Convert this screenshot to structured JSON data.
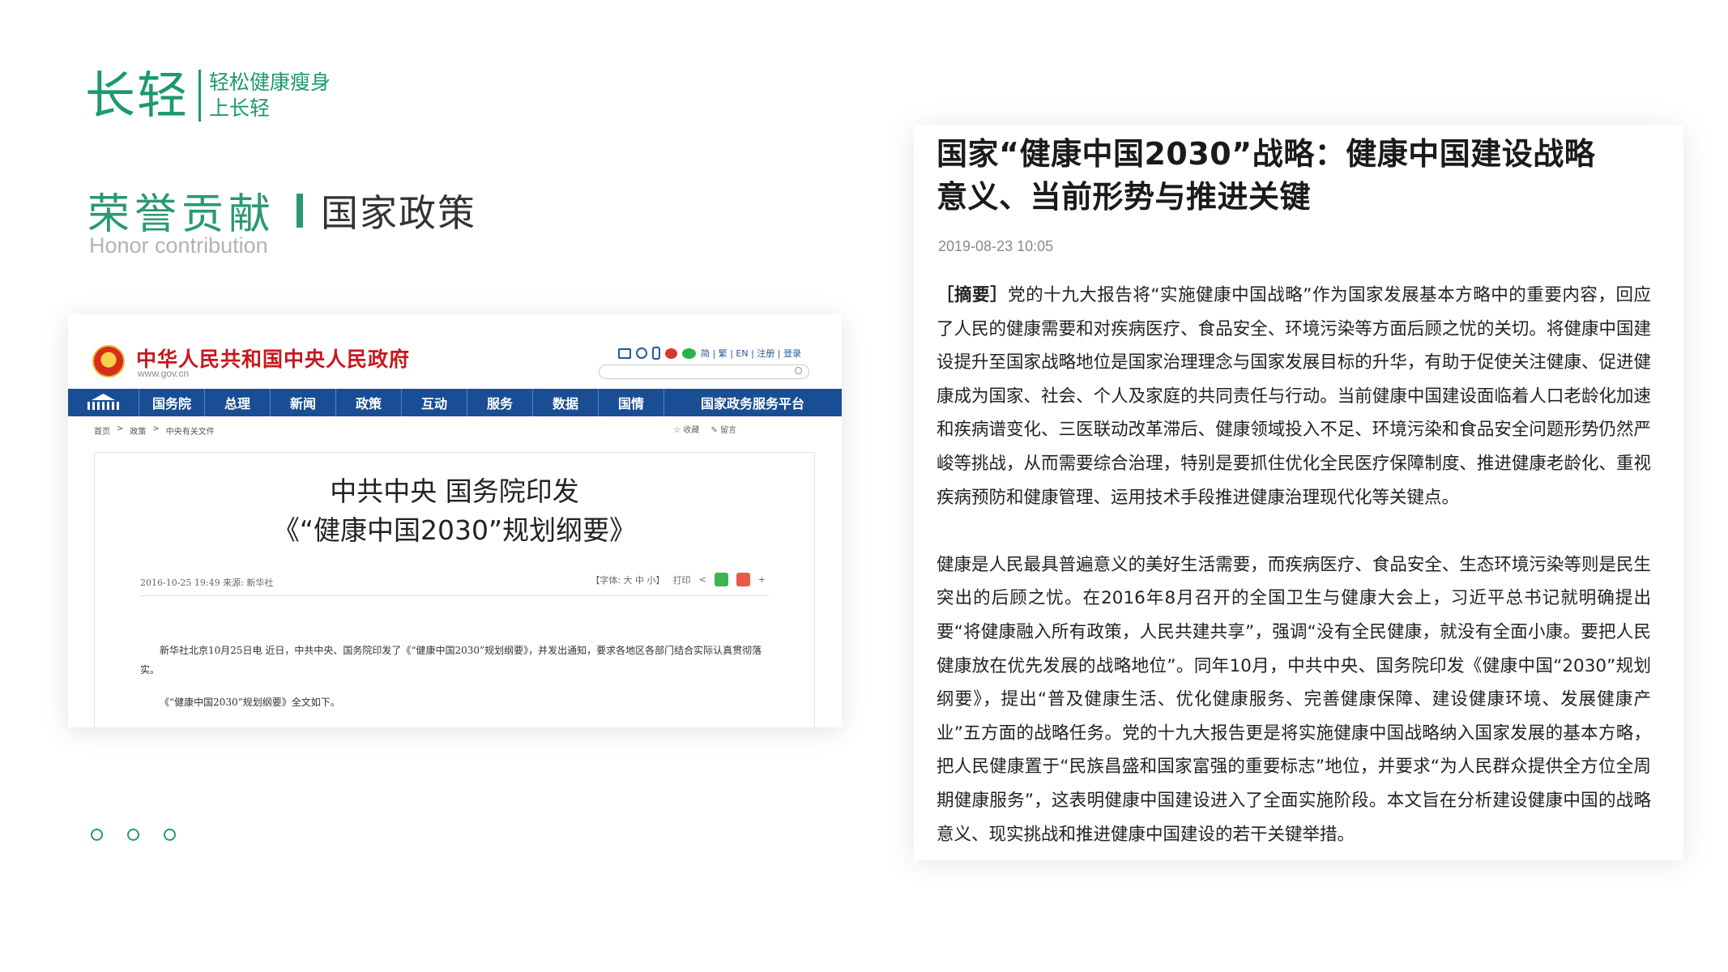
{
  "brand": {
    "logo_text": "长轻",
    "slogan_line1": "轻松健康瘦身",
    "slogan_line2": "上长轻",
    "color": "#1c9a6b"
  },
  "section": {
    "title": "荣誉贡献",
    "subtitle": "国家政策",
    "english": "Honor contribution"
  },
  "gov_site": {
    "title": "中华人民共和国中央人民政府",
    "url": "www.gov.cn",
    "tools": "简 | 繁 | EN | 注册 | 登录",
    "nav": [
      "国务院",
      "总理",
      "新闻",
      "政策",
      "互动",
      "服务",
      "数据",
      "国情",
      "国家政务服务平台"
    ],
    "breadcrumb": [
      "首页",
      ">",
      "政策",
      ">",
      "中央有关文件"
    ],
    "action_fav": "☆ 收藏",
    "action_comment": "✎ 留言",
    "doc_title_line1": "中共中央 国务院印发",
    "doc_title_line2": "《“健康中国2030”规划纲要》",
    "doc_meta": "2016-10-25 19:49   来源:  新华社",
    "doc_font": "【字体: 大 中 小】",
    "doc_print": "打印",
    "doc_para1": "新华社北京10月25日电 近日，中共中央、国务院印发了《“健康中国2030”规划纲要》，并发出通知，要求各地区各部门结合实际认真贯彻落实。",
    "doc_para2": "《“健康中国2030”规划纲要》全文如下。",
    "brand_color": "#1a4e94",
    "title_color": "#c8171c"
  },
  "article": {
    "title": "国家“健康中国2030”战略：健康中国建设战略意义、当前形势与推进关键",
    "date": "2019-08-23 10:05",
    "abstract_label": "［摘要］",
    "abstract_text": "党的十九大报告将“实施健康中国战略”作为国家发展基本方略中的重要内容，回应了人民的健康需要和对疾病医疗、食品安全、环境污染等方面后顾之忧的关切。将健康中国建设提升至国家战略地位是国家治理理念与国家发展目标的升华，有助于促使关注健康、促进健康成为国家、社会、个人及家庭的共同责任与行动。当前健康中国建设面临着人口老龄化加速和疾病谱变化、三医联动改革滞后、健康领域投入不足、环境污染和食品安全问题形势仍然严峻等挑战，从而需要综合治理，特别是要抓住优化全民医疗保障制度、推进健康老龄化、重视疾病预防和健康管理、运用技术手段推进健康治理现代化等关键点。",
    "paragraph2": "健康是人民最具普遍意义的美好生活需要，而疾病医疗、食品安全、生态环境污染等则是民生突出的后顾之忧。在2016年8月召开的全国卫生与健康大会上，习近平总书记就明确提出要“将健康融入所有政策，人民共建共享”，强调“没有全民健康，就没有全面小康。要把人民健康放在优先发展的战略地位”。同年10月，中共中央、国务院印发《健康中国“2030”规划纲要》，提出“普及健康生活、优化健康服务、完善健康保障、建设健康环境、发展健康产业”五方面的战略任务。党的十九大报告更是将实施健康中国战略纳入国家发展的基本方略，把人民健康置于“民族昌盛和国家富强的重要标志”地位，并要求“为人民群众提供全方位全周期健康服务”，这表明健康中国建设进入了全面实施阶段。本文旨在分析建设健康中国的战略意义、现实挑战和推进健康中国建设的若干关键举措。"
  },
  "accent_color": "#2a9872"
}
